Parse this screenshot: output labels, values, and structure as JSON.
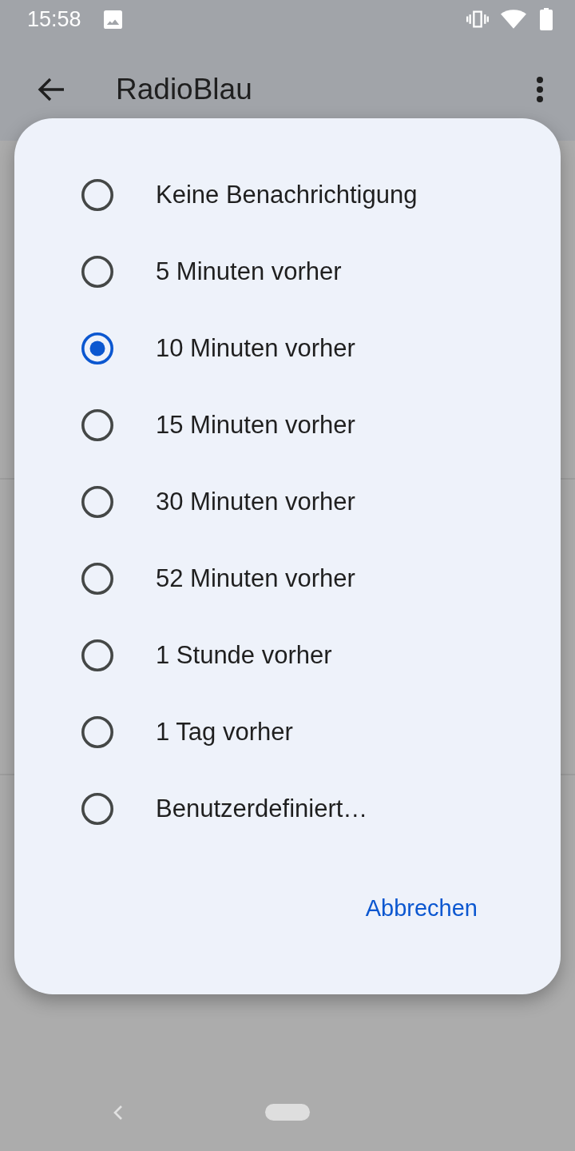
{
  "status_bar": {
    "time": "15:58"
  },
  "app_bar": {
    "title": "RadioBlau"
  },
  "dialog": {
    "options": [
      {
        "label": "Keine Benachrichtigung",
        "selected": false
      },
      {
        "label": "5 Minuten vorher",
        "selected": false
      },
      {
        "label": "10 Minuten vorher",
        "selected": true
      },
      {
        "label": "15 Minuten vorher",
        "selected": false
      },
      {
        "label": "30 Minuten vorher",
        "selected": false
      },
      {
        "label": "52 Minuten vorher",
        "selected": false
      },
      {
        "label": "1 Stunde vorher",
        "selected": false
      },
      {
        "label": "1 Tag vorher",
        "selected": false
      },
      {
        "label": "Benutzerdefiniert…",
        "selected": false
      }
    ],
    "buttons": [
      "Abbrechen"
    ]
  }
}
